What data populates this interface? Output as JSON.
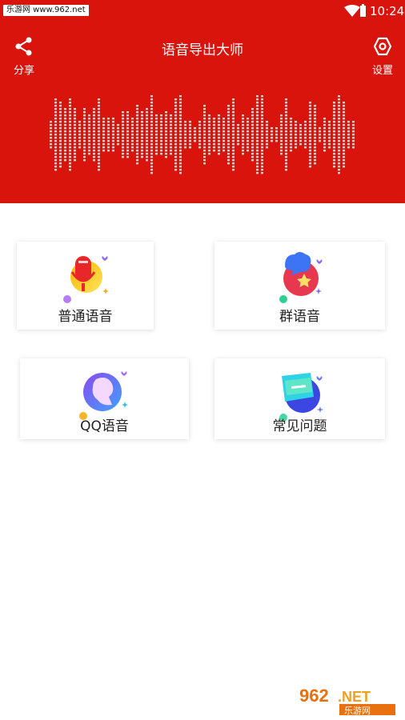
{
  "status_bar": {
    "watermark": "乐游网 www.962.net",
    "time": "10:24"
  },
  "header": {
    "title": "语音导出大师",
    "share_label": "分享",
    "settings_label": "设置",
    "color": "#d8140d"
  },
  "cards": [
    {
      "label": "普通语音",
      "icon": "microphone-icon"
    },
    {
      "label": "群语音",
      "icon": "group-chat-icon"
    },
    {
      "label": "QQ语音",
      "icon": "qq-voice-icon"
    },
    {
      "label": "常见问题",
      "icon": "faq-icon"
    }
  ],
  "watermark_bottom": {
    "brand": "962.NET",
    "subtitle": "乐游网"
  }
}
